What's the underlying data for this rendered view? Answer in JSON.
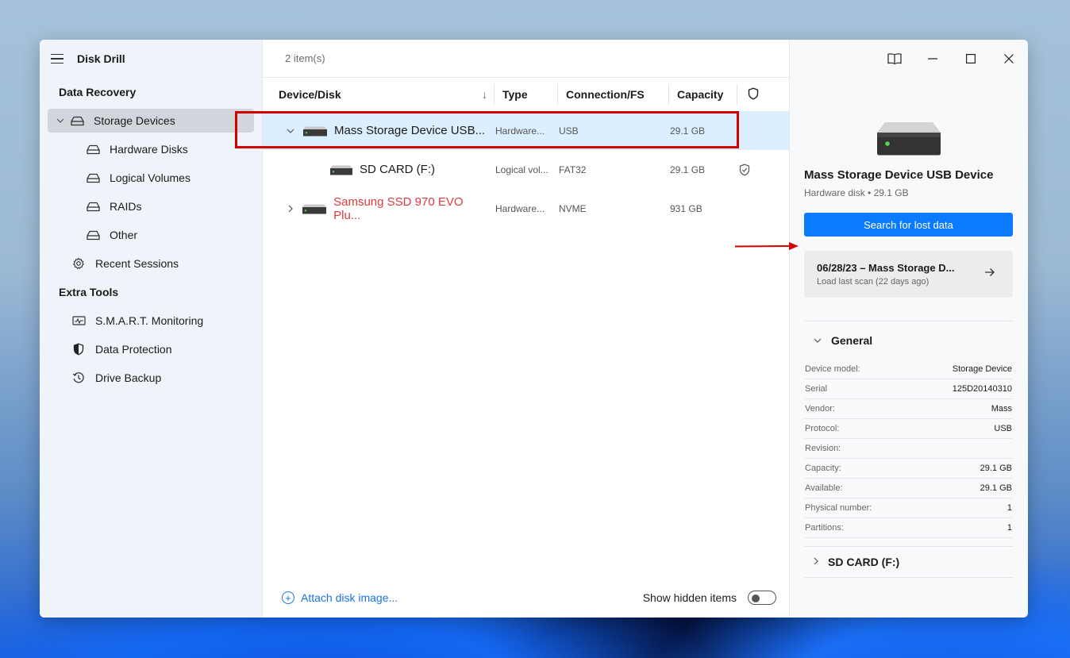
{
  "app": {
    "title": "Disk Drill"
  },
  "sidebar": {
    "sections": [
      {
        "title": "Data Recovery"
      },
      {
        "title": "Extra Tools"
      }
    ],
    "items": [
      {
        "label": "Storage Devices",
        "icon": "drive-icon",
        "active": true,
        "expanded": true
      },
      {
        "label": "Hardware Disks",
        "icon": "drive-icon"
      },
      {
        "label": "Logical Volumes",
        "icon": "drive-icon"
      },
      {
        "label": "RAIDs",
        "icon": "drive-icon"
      },
      {
        "label": "Other",
        "icon": "drive-icon"
      },
      {
        "label": "Recent Sessions",
        "icon": "gear-icon"
      },
      {
        "label": "S.M.A.R.T. Monitoring",
        "icon": "monitor-pulse-icon"
      },
      {
        "label": "Data Protection",
        "icon": "shield-half-icon"
      },
      {
        "label": "Drive Backup",
        "icon": "history-icon"
      }
    ]
  },
  "main": {
    "item_count": "2 item(s)",
    "columns": [
      "Device/Disk",
      "Type",
      "Connection/FS",
      "Capacity"
    ],
    "sort_indicator": "↓",
    "rows": [
      {
        "name": "Mass Storage Device USB...",
        "type": "Hardware...",
        "conn": "USB",
        "capacity": "29.1 GB",
        "expanded": true,
        "selected": true,
        "protected": false
      },
      {
        "name": "SD CARD (F:)",
        "type": "Logical vol...",
        "conn": "FAT32",
        "capacity": "29.1 GB",
        "child": true,
        "protected": true
      },
      {
        "name": "Samsung SSD 970 EVO Plu...",
        "type": "Hardware...",
        "conn": "NVME",
        "capacity": "931 GB",
        "expanded": false,
        "warning": true,
        "protected": false
      }
    ],
    "footer": {
      "attach_label": "Attach disk image...",
      "hidden_label": "Show hidden items",
      "hidden_on": false
    }
  },
  "details": {
    "title": "Mass Storage Device USB Device",
    "subtitle": "Hardware disk • 29.1 GB",
    "search_button": "Search for lost data",
    "last_scan": {
      "title": "06/28/23 – Mass Storage D...",
      "subtitle": "Load last scan (22 days ago)"
    },
    "general_label": "General",
    "properties": [
      {
        "key": "Device model:",
        "value": "Storage Device"
      },
      {
        "key": "Serial",
        "value": "125D20140310"
      },
      {
        "key": "Vendor:",
        "value": "Mass"
      },
      {
        "key": "Protocol:",
        "value": "USB"
      },
      {
        "key": "Revision:",
        "value": ""
      },
      {
        "key": "Capacity:",
        "value": "29.1 GB"
      },
      {
        "key": "Available:",
        "value": "29.1 GB"
      },
      {
        "key": "Physical number:",
        "value": "1"
      },
      {
        "key": "Partitions:",
        "value": "1"
      }
    ],
    "partition_label": "SD CARD (F:)"
  },
  "colors": {
    "accent": "#0a7aff",
    "link": "#1a73e8",
    "warning_text": "#e0393e",
    "selection": "#dcefff",
    "annotation": "#d40000"
  }
}
